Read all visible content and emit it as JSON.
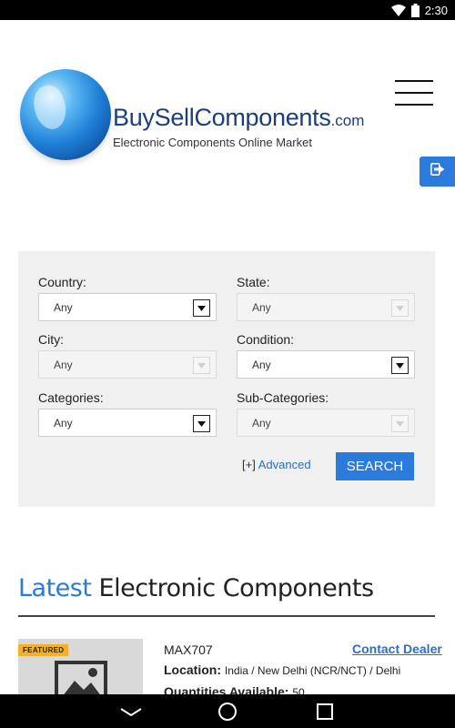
{
  "status_bar": {
    "time": "2:30",
    "icons": [
      "wifi-icon",
      "battery-icon"
    ]
  },
  "header": {
    "brand_main": "BuySellComponents",
    "brand_suffix": ".com",
    "tagline": "Electronic Components Online Market",
    "menu_icon": "hamburger-menu-icon",
    "login_icon": "sign-in-icon"
  },
  "search": {
    "fields": [
      {
        "label": "Country:",
        "value": "Any",
        "enabled": true
      },
      {
        "label": "State:",
        "value": "Any",
        "enabled": false
      },
      {
        "label": "City:",
        "value": "Any",
        "enabled": false
      },
      {
        "label": "Condition:",
        "value": "Any",
        "enabled": true
      },
      {
        "label": "Categories:",
        "value": "Any",
        "enabled": true
      },
      {
        "label": "Sub-Categories:",
        "value": "Any",
        "enabled": false
      }
    ],
    "advanced_prefix": "[+]",
    "advanced_label": "Advanced",
    "button_label": "SEARCH"
  },
  "latest": {
    "title_accent": "Latest",
    "title_rest": "Electronic Components",
    "items": [
      {
        "badge": "FEATURED",
        "name": "MAX707",
        "contact_label": "Contact Dealer",
        "location_label": "Location:",
        "location_value": "India / New Delhi (NCR/NCT) / Delhi",
        "quantity_label": "Quantities Available:",
        "quantity_value": "50"
      }
    ]
  },
  "nav_bar": {
    "buttons": [
      "back-icon",
      "home-icon",
      "recents-icon"
    ]
  },
  "colors": {
    "accent": "#2b7bdc",
    "brand": "#1a3f7a",
    "badge": "#f2b12a",
    "panel": "#f0f0f0"
  }
}
